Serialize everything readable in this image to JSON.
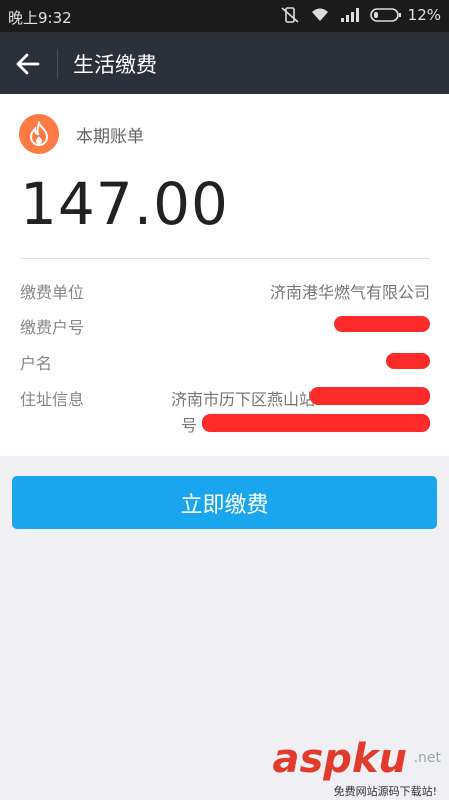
{
  "status_bar": {
    "time": "晚上9:32",
    "battery": "12%"
  },
  "app_bar": {
    "title": "生活缴费"
  },
  "bill": {
    "section_label": "本期账单",
    "amount": "147.00",
    "rows": [
      {
        "label": "缴费单位",
        "value": "济南港华燃气有限公司"
      },
      {
        "label": "缴费户号",
        "value": ""
      },
      {
        "label": "户名",
        "value": ""
      },
      {
        "label": "住址信息",
        "value_line1": "济南市历下区燕山站",
        "value_line2": "号"
      }
    ]
  },
  "pay_button": {
    "label": "立即缴费"
  },
  "watermark": {
    "logo": "aspku",
    "suffix": ".net",
    "tagline": "免费网站源码下载站!"
  },
  "colors": {
    "accent": "#1aa5ef",
    "app_bar": "#2a313a",
    "icon_bg": "#ff7a45",
    "redaction": "#ff2b2b"
  }
}
